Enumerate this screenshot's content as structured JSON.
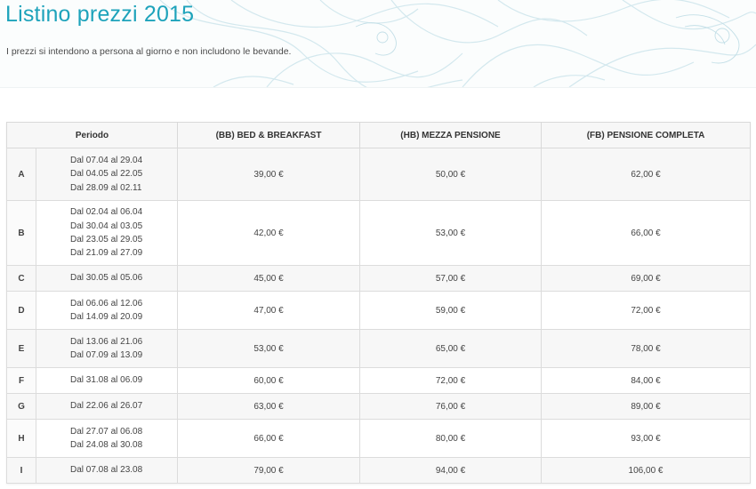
{
  "page": {
    "title": "Listino prezzi 2015",
    "subtitle": "I prezzi si intendono a persona al giorno e non includono le bevande."
  },
  "colors": {
    "title": "#1ea3bb",
    "decor": "#cfe6ec"
  },
  "table": {
    "headers": {
      "period": "Periodo",
      "bb": "(BB) BED & BREAKFAST",
      "hb": "(HB) MEZZA PENSIONE",
      "fb": "(FB) PENSIONE COMPLETA"
    },
    "rows": [
      {
        "letter": "A",
        "periods": [
          "Dal 07.04 al 29.04",
          "Dal 04.05 al 22.05",
          "Dal 28.09 al 02.11"
        ],
        "bb": "39,00 €",
        "hb": "50,00 €",
        "fb": "62,00 €"
      },
      {
        "letter": "B",
        "periods": [
          "Dal 02.04 al 06.04",
          "Dal 30.04 al 03.05",
          "Dal 23.05 al 29.05",
          "Dal 21.09 al 27.09"
        ],
        "bb": "42,00 €",
        "hb": "53,00 €",
        "fb": "66,00 €"
      },
      {
        "letter": "C",
        "periods": [
          "Dal 30.05 al 05.06"
        ],
        "bb": "45,00 €",
        "hb": "57,00 €",
        "fb": "69,00 €"
      },
      {
        "letter": "D",
        "periods": [
          "Dal 06.06 al 12.06",
          "Dal 14.09 al 20.09"
        ],
        "bb": "47,00 €",
        "hb": "59,00 €",
        "fb": "72,00 €"
      },
      {
        "letter": "E",
        "periods": [
          "Dal 13.06 al 21.06",
          "Dal 07.09 al 13.09"
        ],
        "bb": "53,00 €",
        "hb": "65,00 €",
        "fb": "78,00 €"
      },
      {
        "letter": "F",
        "periods": [
          "Dal 31.08 al 06.09"
        ],
        "bb": "60,00 €",
        "hb": "72,00 €",
        "fb": "84,00 €"
      },
      {
        "letter": "G",
        "periods": [
          "Dal 22.06 al 26.07"
        ],
        "bb": "63,00 €",
        "hb": "76,00 €",
        "fb": "89,00 €"
      },
      {
        "letter": "H",
        "periods": [
          "Dal 27.07 al 06.08",
          "Dal 24.08 al 30.08"
        ],
        "bb": "66,00 €",
        "hb": "80,00 €",
        "fb": "93,00 €"
      },
      {
        "letter": "I",
        "periods": [
          "Dal 07.08 al 23.08"
        ],
        "bb": "79,00 €",
        "hb": "94,00 €",
        "fb": "106,00 €"
      }
    ]
  }
}
